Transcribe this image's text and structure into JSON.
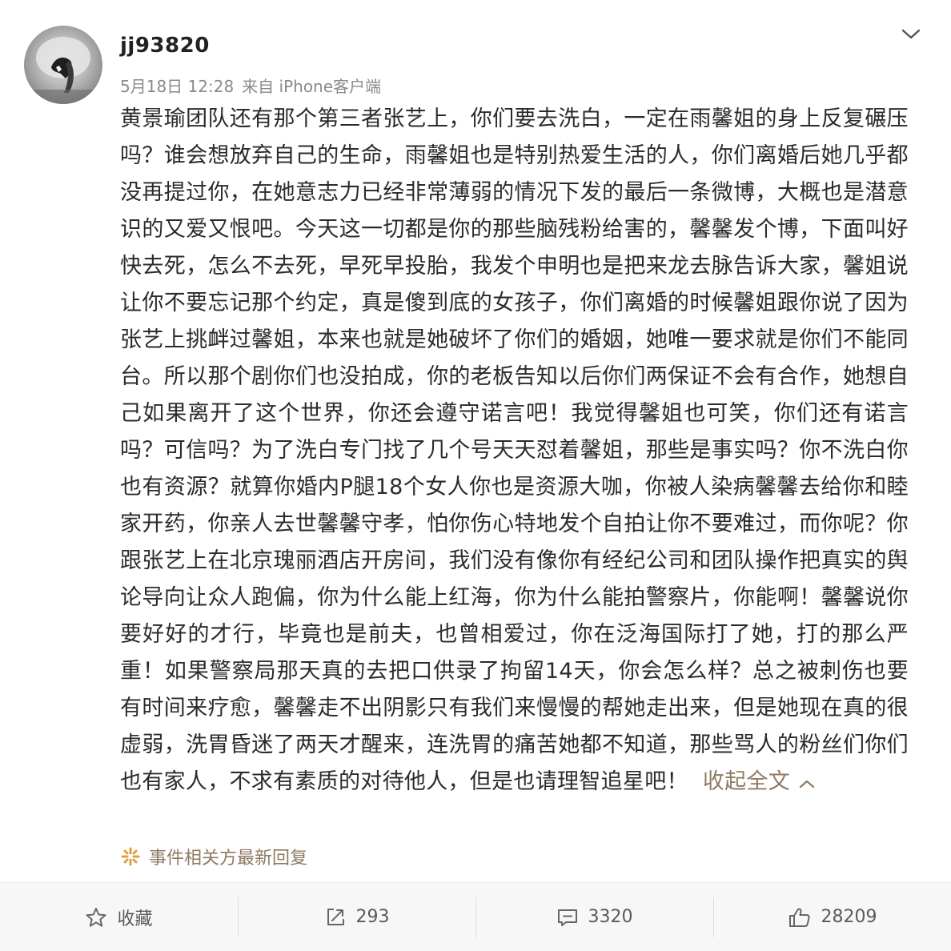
{
  "post": {
    "username": "jj93820",
    "date": "5月18日 12:28",
    "source": "来自 iPhone客户端",
    "body": "黄景瑜团队还有那个第三者张艺上，你们要去洗白，一定在雨馨姐的身上反复碾压吗？谁会想放弃自己的生命，雨馨姐也是特别热爱生活的人，你们离婚后她几乎都没再提过你，在她意志力已经非常薄弱的情况下发的最后一条微博，大概也是潜意识的又爱又恨吧。今天这一切都是你的那些脑残粉给害的，馨馨发个博，下面叫好快去死，怎么不去死，早死早投胎，我发个申明也是把来龙去脉告诉大家，馨姐说让你不要忘记那个约定，真是傻到底的女孩子，你们离婚的时候馨姐跟你说了因为张艺上挑衅过馨姐，本来也就是她破坏了你们的婚姻，她唯一要求就是你们不能同台。所以那个剧你们也没拍成，你的老板告知以后你们两保证不会有合作，她想自己如果离开了这个世界，你还会遵守诺言吧！我觉得馨姐也可笑，你们还有诺言吗？可信吗？为了洗白专门找了几个号天天怼着馨姐，那些是事实吗？你不洗白你也有资源？就算你婚内P腿18个女人你也是资源大咖，你被人染病馨馨去给你和睦家开药，你亲人去世馨馨守孝，怕你伤心特地发个自拍让你不要难过，而你呢？你跟张艺上在北京瑰丽酒店开房间，我们没有像你有经纪公司和团队操作把真实的舆论导向让众人跑偏，你为什么能上红海，你为什么能拍警察片，你能啊！馨馨说你要好好的才行，毕竟也是前夫，也曾相爱过，你在泛海国际打了她，打的那么严重！如果警察局那天真的去把口供录了拘留14天，你会怎么样？总之被刺伤也要有时间来疗愈，馨馨走不出阴影只有我们来慢慢的帮她走出来，但是她现在真的很虚弱，洗胃昏迷了两天才醒来，连洗胃的痛苦她都不知道，那些骂人的粉丝们你们也有家人，不求有素质的对待他人，但是也请理智追星吧！",
    "collapse_label": "收起全文",
    "related_label": "事件相关方最新回复"
  },
  "actions": {
    "favorite_label": "收藏",
    "repost_count": "293",
    "comment_count": "3320",
    "like_count": "28209"
  },
  "icons": {
    "menu": "chevron-down-icon",
    "collapse": "chevron-up-icon",
    "related": "spark-icon",
    "favorite": "star-icon",
    "repost": "share-icon",
    "comment": "comment-icon",
    "like": "thumbs-up-icon"
  },
  "colors": {
    "link": "#8f7a62",
    "text": "#2b2b2b",
    "meta": "#8a8a8a",
    "footer_bg": "#f7f7f7"
  }
}
